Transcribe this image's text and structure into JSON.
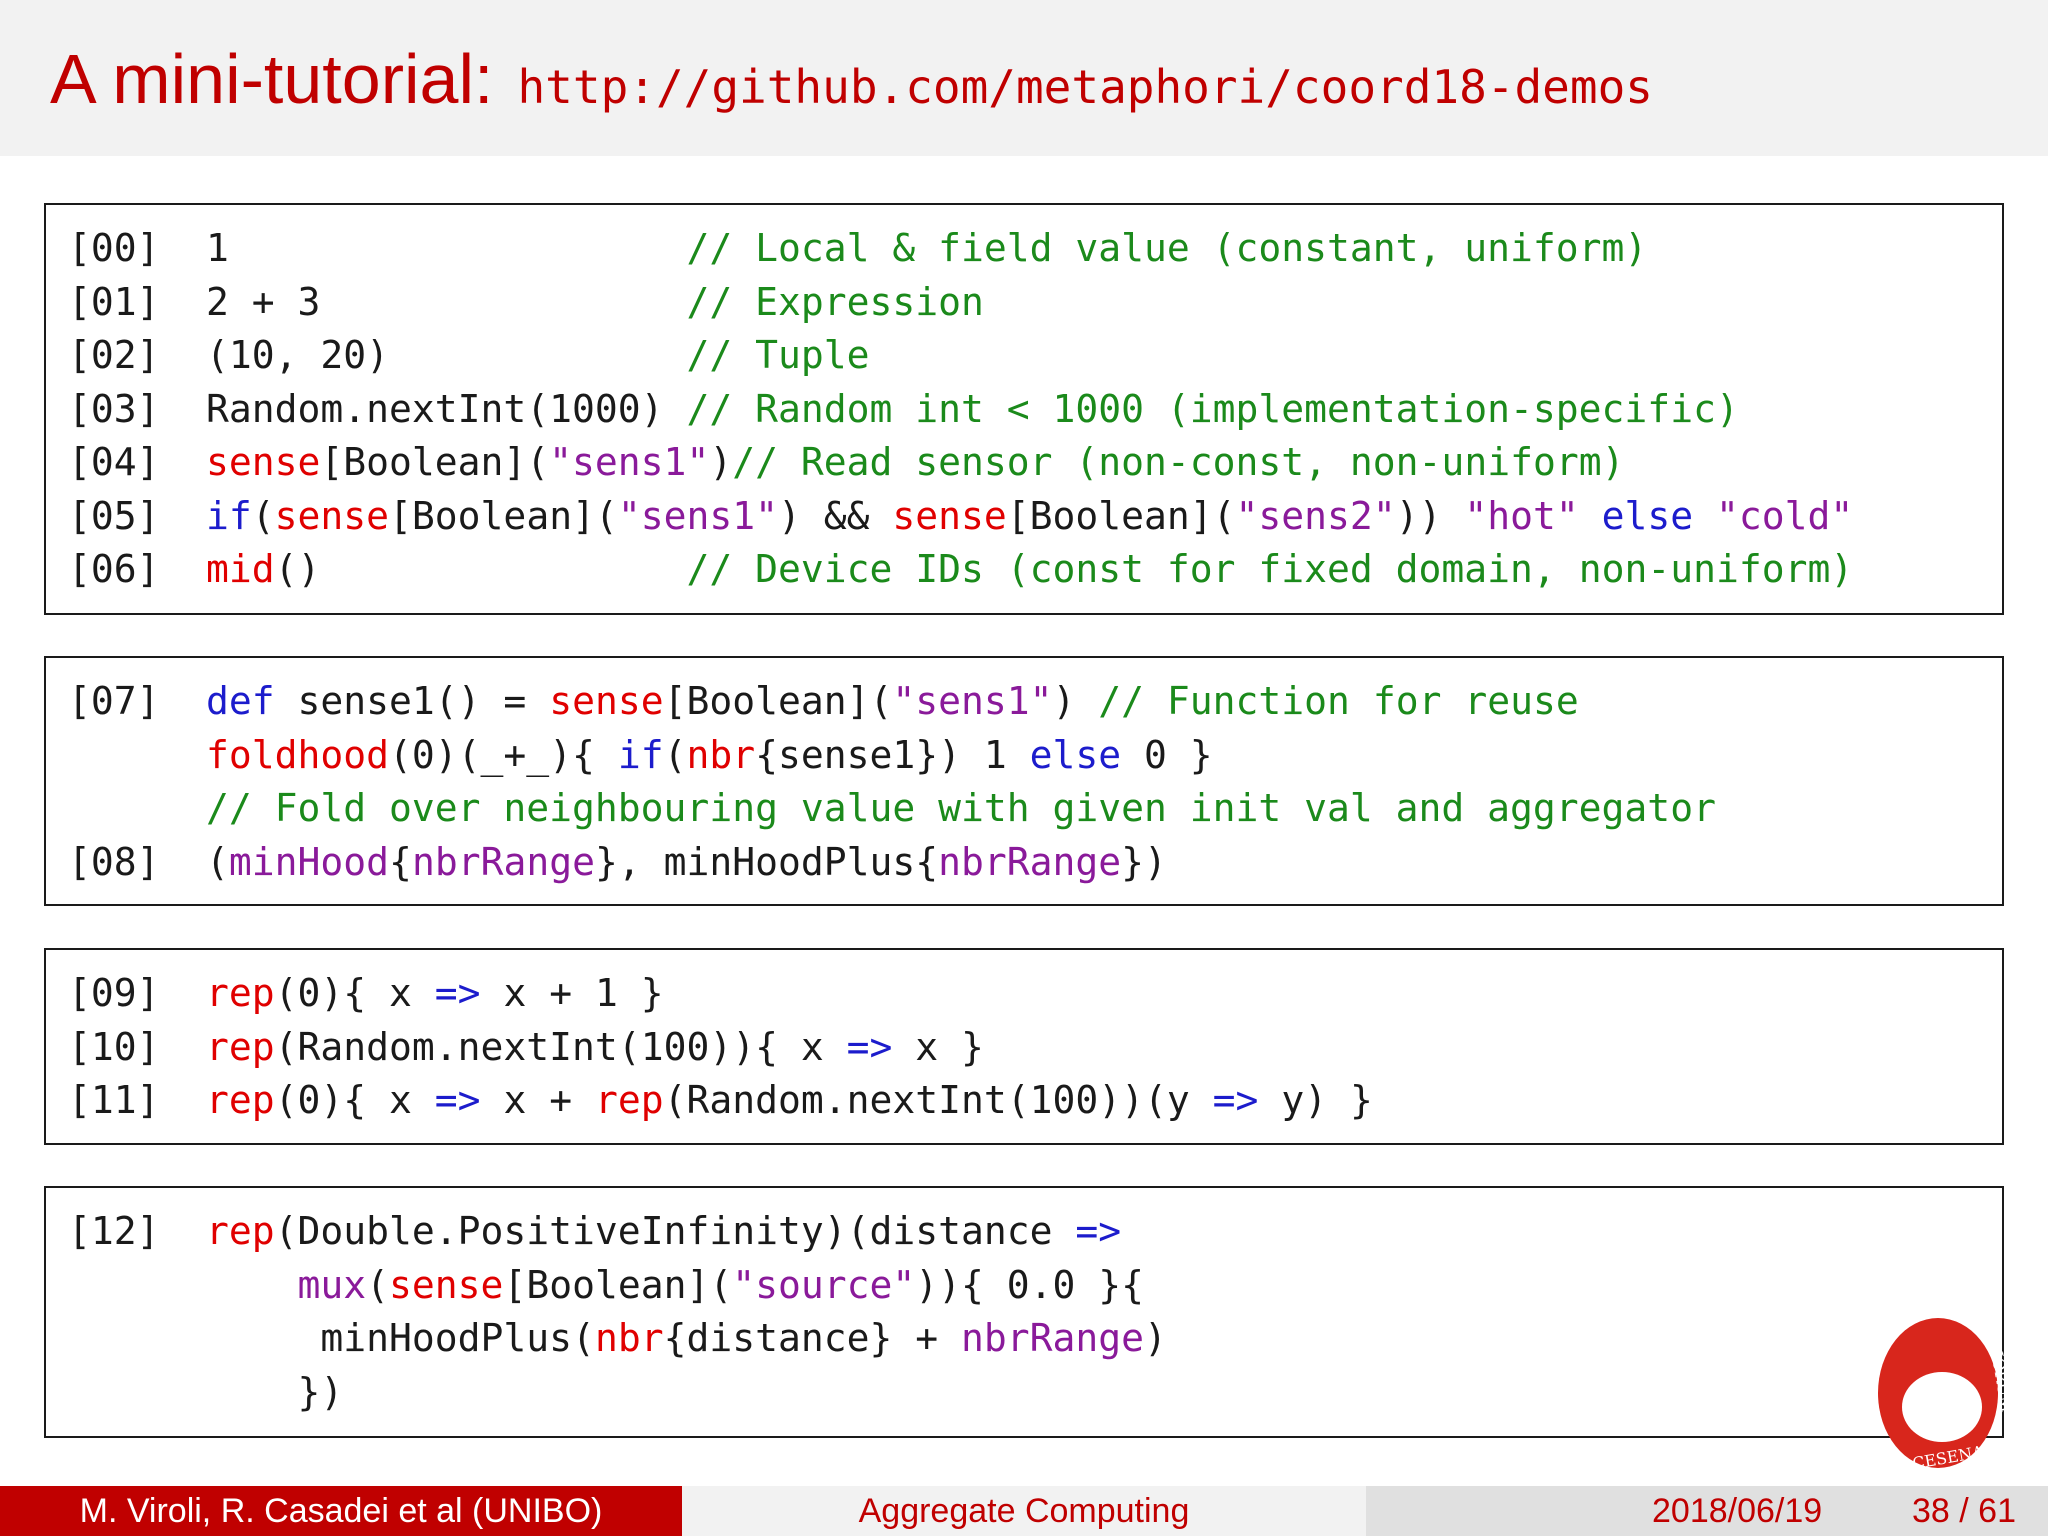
{
  "header": {
    "title": "A mini-tutorial:",
    "url": "http://github.com/metaphori/coord18-demos"
  },
  "code_blocks": [
    {
      "lines": [
        {
          "num": "[00]",
          "tokens": [
            [
              "plain",
              "1                    "
            ],
            [
              "comment",
              "// Local & field value (constant, uniform)"
            ]
          ]
        },
        {
          "num": "[01]",
          "tokens": [
            [
              "plain",
              "2 + 3                "
            ],
            [
              "comment",
              "// Expression"
            ]
          ]
        },
        {
          "num": "[02]",
          "tokens": [
            [
              "plain",
              "(10, 20)             "
            ],
            [
              "comment",
              "// Tuple"
            ]
          ]
        },
        {
          "num": "[03]",
          "tokens": [
            [
              "plain",
              "Random.nextInt(1000) "
            ],
            [
              "comment",
              "// Random int < 1000 (implementation-specific)"
            ]
          ]
        },
        {
          "num": "[04]",
          "tokens": [
            [
              "builtin",
              "sense"
            ],
            [
              "plain",
              "[Boolean]("
            ],
            [
              "string",
              "\"sens1\""
            ],
            [
              "plain",
              ")"
            ],
            [
              "comment",
              "// Read sensor (non-const, non-uniform)"
            ]
          ]
        },
        {
          "num": "[05]",
          "tokens": [
            [
              "keyword",
              "if"
            ],
            [
              "plain",
              "("
            ],
            [
              "builtin",
              "sense"
            ],
            [
              "plain",
              "[Boolean]("
            ],
            [
              "string",
              "\"sens1\""
            ],
            [
              "plain",
              ") && "
            ],
            [
              "builtin",
              "sense"
            ],
            [
              "plain",
              "[Boolean]("
            ],
            [
              "string",
              "\"sens2\""
            ],
            [
              "plain",
              ")) "
            ],
            [
              "string",
              "\"hot\""
            ],
            [
              "plain",
              " "
            ],
            [
              "keyword",
              "else"
            ],
            [
              "plain",
              " "
            ],
            [
              "string",
              "\"cold\""
            ]
          ]
        },
        {
          "num": "[06]",
          "tokens": [
            [
              "builtin",
              "mid"
            ],
            [
              "plain",
              "()                "
            ],
            [
              "comment",
              "// Device IDs (const for fixed domain, non-uniform)"
            ]
          ]
        }
      ]
    },
    {
      "lines": [
        {
          "num": "[07]",
          "tokens": [
            [
              "keyword",
              "def"
            ],
            [
              "plain",
              " sense1() = "
            ],
            [
              "builtin",
              "sense"
            ],
            [
              "plain",
              "[Boolean]("
            ],
            [
              "string",
              "\"sens1\""
            ],
            [
              "plain",
              ") "
            ],
            [
              "comment",
              "// Function for reuse"
            ]
          ]
        },
        {
          "num": "",
          "tokens": [
            [
              "builtin",
              "foldhood"
            ],
            [
              "plain",
              "(0)(_+_){ "
            ],
            [
              "keyword",
              "if"
            ],
            [
              "plain",
              "("
            ],
            [
              "builtin",
              "nbr"
            ],
            [
              "plain",
              "{sense1}) 1 "
            ],
            [
              "keyword",
              "else"
            ],
            [
              "plain",
              " 0 }"
            ]
          ]
        },
        {
          "num": "",
          "tokens": [
            [
              "comment",
              "// Fold over neighbouring value with given init val and aggregator"
            ]
          ]
        },
        {
          "num": "[08]",
          "tokens": [
            [
              "plain",
              "("
            ],
            [
              "call",
              "minHood"
            ],
            [
              "plain",
              "{"
            ],
            [
              "call",
              "nbrRange"
            ],
            [
              "plain",
              "}, minHoodPlus{"
            ],
            [
              "call",
              "nbrRange"
            ],
            [
              "plain",
              "})"
            ]
          ]
        }
      ]
    },
    {
      "lines": [
        {
          "num": "[09]",
          "tokens": [
            [
              "builtin",
              "rep"
            ],
            [
              "plain",
              "(0){ x "
            ],
            [
              "keyword",
              "=>"
            ],
            [
              "plain",
              " x + 1 }"
            ]
          ]
        },
        {
          "num": "[10]",
          "tokens": [
            [
              "builtin",
              "rep"
            ],
            [
              "plain",
              "(Random.nextInt(100)){ x "
            ],
            [
              "keyword",
              "=>"
            ],
            [
              "plain",
              " x }"
            ]
          ]
        },
        {
          "num": "[11]",
          "tokens": [
            [
              "builtin",
              "rep"
            ],
            [
              "plain",
              "(0){ x "
            ],
            [
              "keyword",
              "=>"
            ],
            [
              "plain",
              " x + "
            ],
            [
              "builtin",
              "rep"
            ],
            [
              "plain",
              "(Random.nextInt(100))(y "
            ],
            [
              "keyword",
              "=>"
            ],
            [
              "plain",
              " y) }"
            ]
          ]
        }
      ]
    },
    {
      "lines": [
        {
          "num": "[12]",
          "tokens": [
            [
              "builtin",
              "rep"
            ],
            [
              "plain",
              "(Double.PositiveInfinity)(distance "
            ],
            [
              "keyword",
              "=>"
            ]
          ]
        },
        {
          "num": "",
          "tokens": [
            [
              "plain",
              "    "
            ],
            [
              "call",
              "mux"
            ],
            [
              "plain",
              "("
            ],
            [
              "builtin",
              "sense"
            ],
            [
              "plain",
              "[Boolean]("
            ],
            [
              "string",
              "\"source\""
            ],
            [
              "plain",
              ")){ 0.0 }{"
            ]
          ]
        },
        {
          "num": "",
          "tokens": [
            [
              "plain",
              "     minHoodPlus("
            ],
            [
              "builtin",
              "nbr"
            ],
            [
              "plain",
              "{distance} + "
            ],
            [
              "call",
              "nbrRange"
            ],
            [
              "plain",
              ")"
            ]
          ]
        },
        {
          "num": "",
          "tokens": [
            [
              "plain",
              "    })"
            ]
          ]
        }
      ]
    }
  ],
  "seal": {
    "text_1": "IORUM",
    "text_2": "CESENA"
  },
  "footer": {
    "authors": "M. Viroli, R. Casadei et al  (UNIBO)",
    "talk_title": "Aggregate Computing",
    "date": "2018/06/19",
    "page": "38 / 61"
  },
  "colors": {
    "accent": "#c00000",
    "comment": "#1b8a1b",
    "keyword": "#1c1ccc",
    "builtin": "#e00000",
    "string": "#8a1a9a"
  }
}
